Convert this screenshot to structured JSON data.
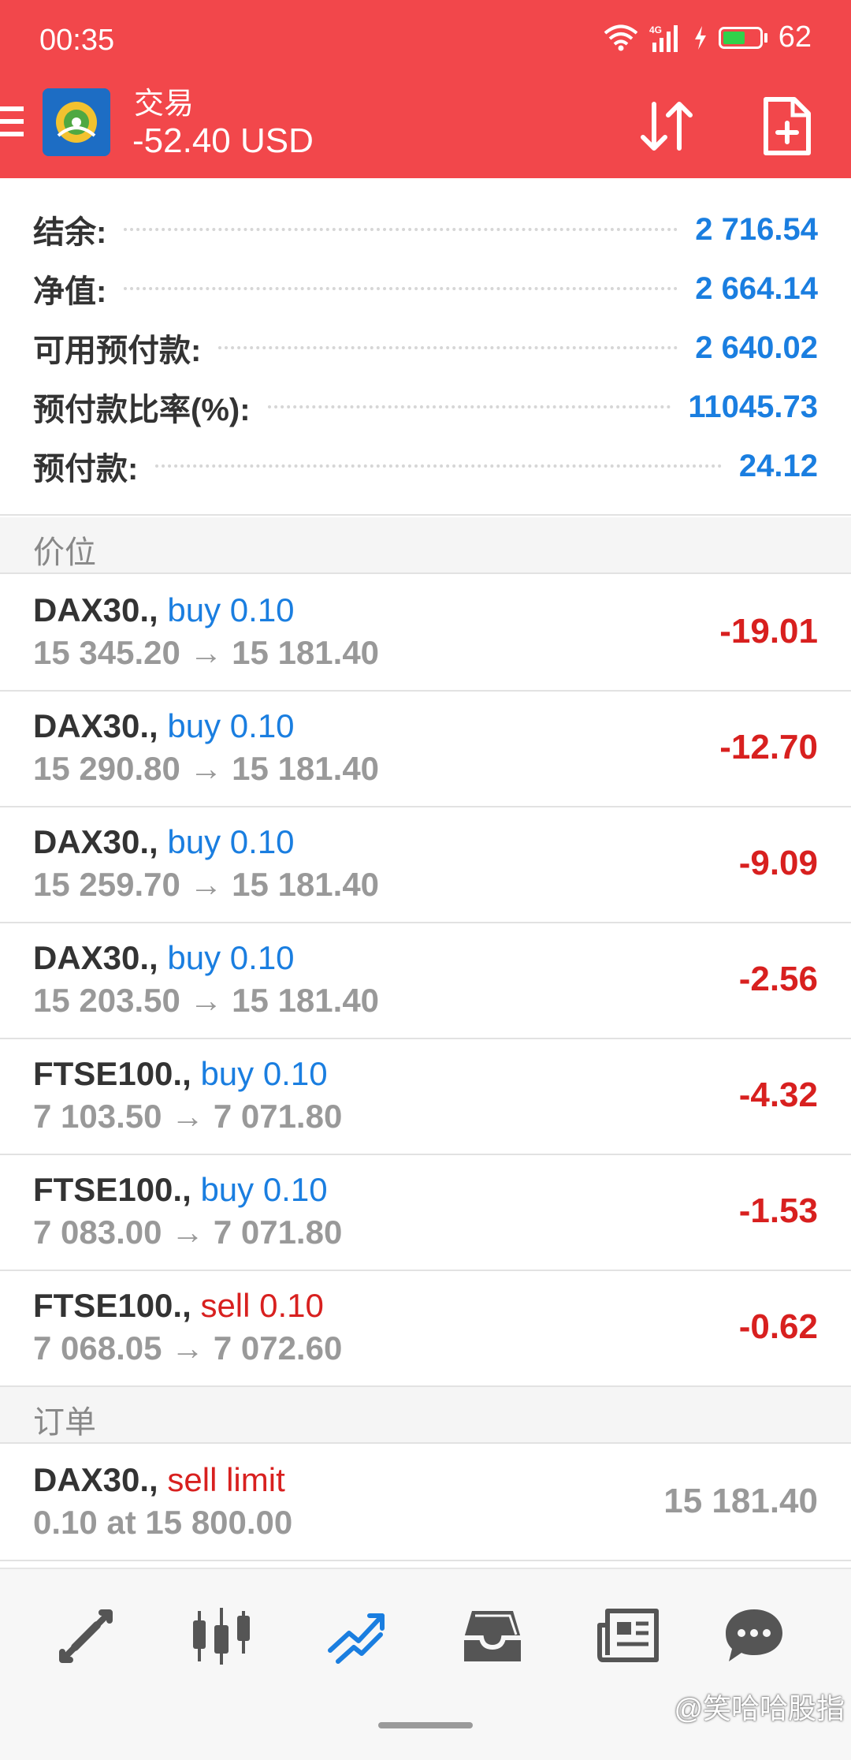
{
  "status_bar": {
    "time": "00:35",
    "network": "4G",
    "battery_level": "62"
  },
  "app_bar": {
    "title": "交易",
    "balance": "-52.40 USD"
  },
  "summary": [
    {
      "label": "结余:",
      "value": "2 716.54"
    },
    {
      "label": "净值:",
      "value": "2 664.14"
    },
    {
      "label": "可用预付款:",
      "value": "2 640.02"
    },
    {
      "label": "预付款比率(%):",
      "value": "11045.73"
    },
    {
      "label": "预付款:",
      "value": "24.12"
    }
  ],
  "sections": {
    "positions": "价位",
    "orders": "订单"
  },
  "positions": [
    {
      "symbol": "DAX30.,",
      "side": "buy 0.10",
      "prices": "15 345.20 → 15 181.40",
      "profit": "-19.01"
    },
    {
      "symbol": "DAX30.,",
      "side": "buy 0.10",
      "prices": "15 290.80 → 15 181.40",
      "profit": "-12.70"
    },
    {
      "symbol": "DAX30.,",
      "side": "buy 0.10",
      "prices": "15 259.70 → 15 181.40",
      "profit": "-9.09"
    },
    {
      "symbol": "DAX30.,",
      "side": "buy 0.10",
      "prices": "15 203.50 → 15 181.40",
      "profit": "-2.56"
    },
    {
      "symbol": "FTSE100.,",
      "side": "buy 0.10",
      "prices": "7 103.50 → 7 071.80",
      "profit": "-4.32"
    },
    {
      "symbol": "FTSE100.,",
      "side": "buy 0.10",
      "prices": "7 083.00 → 7 071.80",
      "profit": "-1.53"
    },
    {
      "symbol": "FTSE100.,",
      "side": "sell 0.10",
      "prices": "7 068.05 → 7 072.60",
      "profit": "-0.62"
    }
  ],
  "orders": [
    {
      "symbol": "DAX30.,",
      "side": "sell limit",
      "detail": "0.10 at 15 800.00",
      "price": "15 181.40"
    }
  ],
  "bottom_nav": [
    "quotes-icon",
    "chart-icon",
    "trade-icon",
    "history-icon",
    "news-icon",
    "chat-icon"
  ],
  "watermark": "@笑哈哈股指",
  "colors": {
    "header": "#f2474b",
    "accent_blue": "#1a7ee0",
    "loss_red": "#d8201f",
    "muted": "#999999"
  }
}
